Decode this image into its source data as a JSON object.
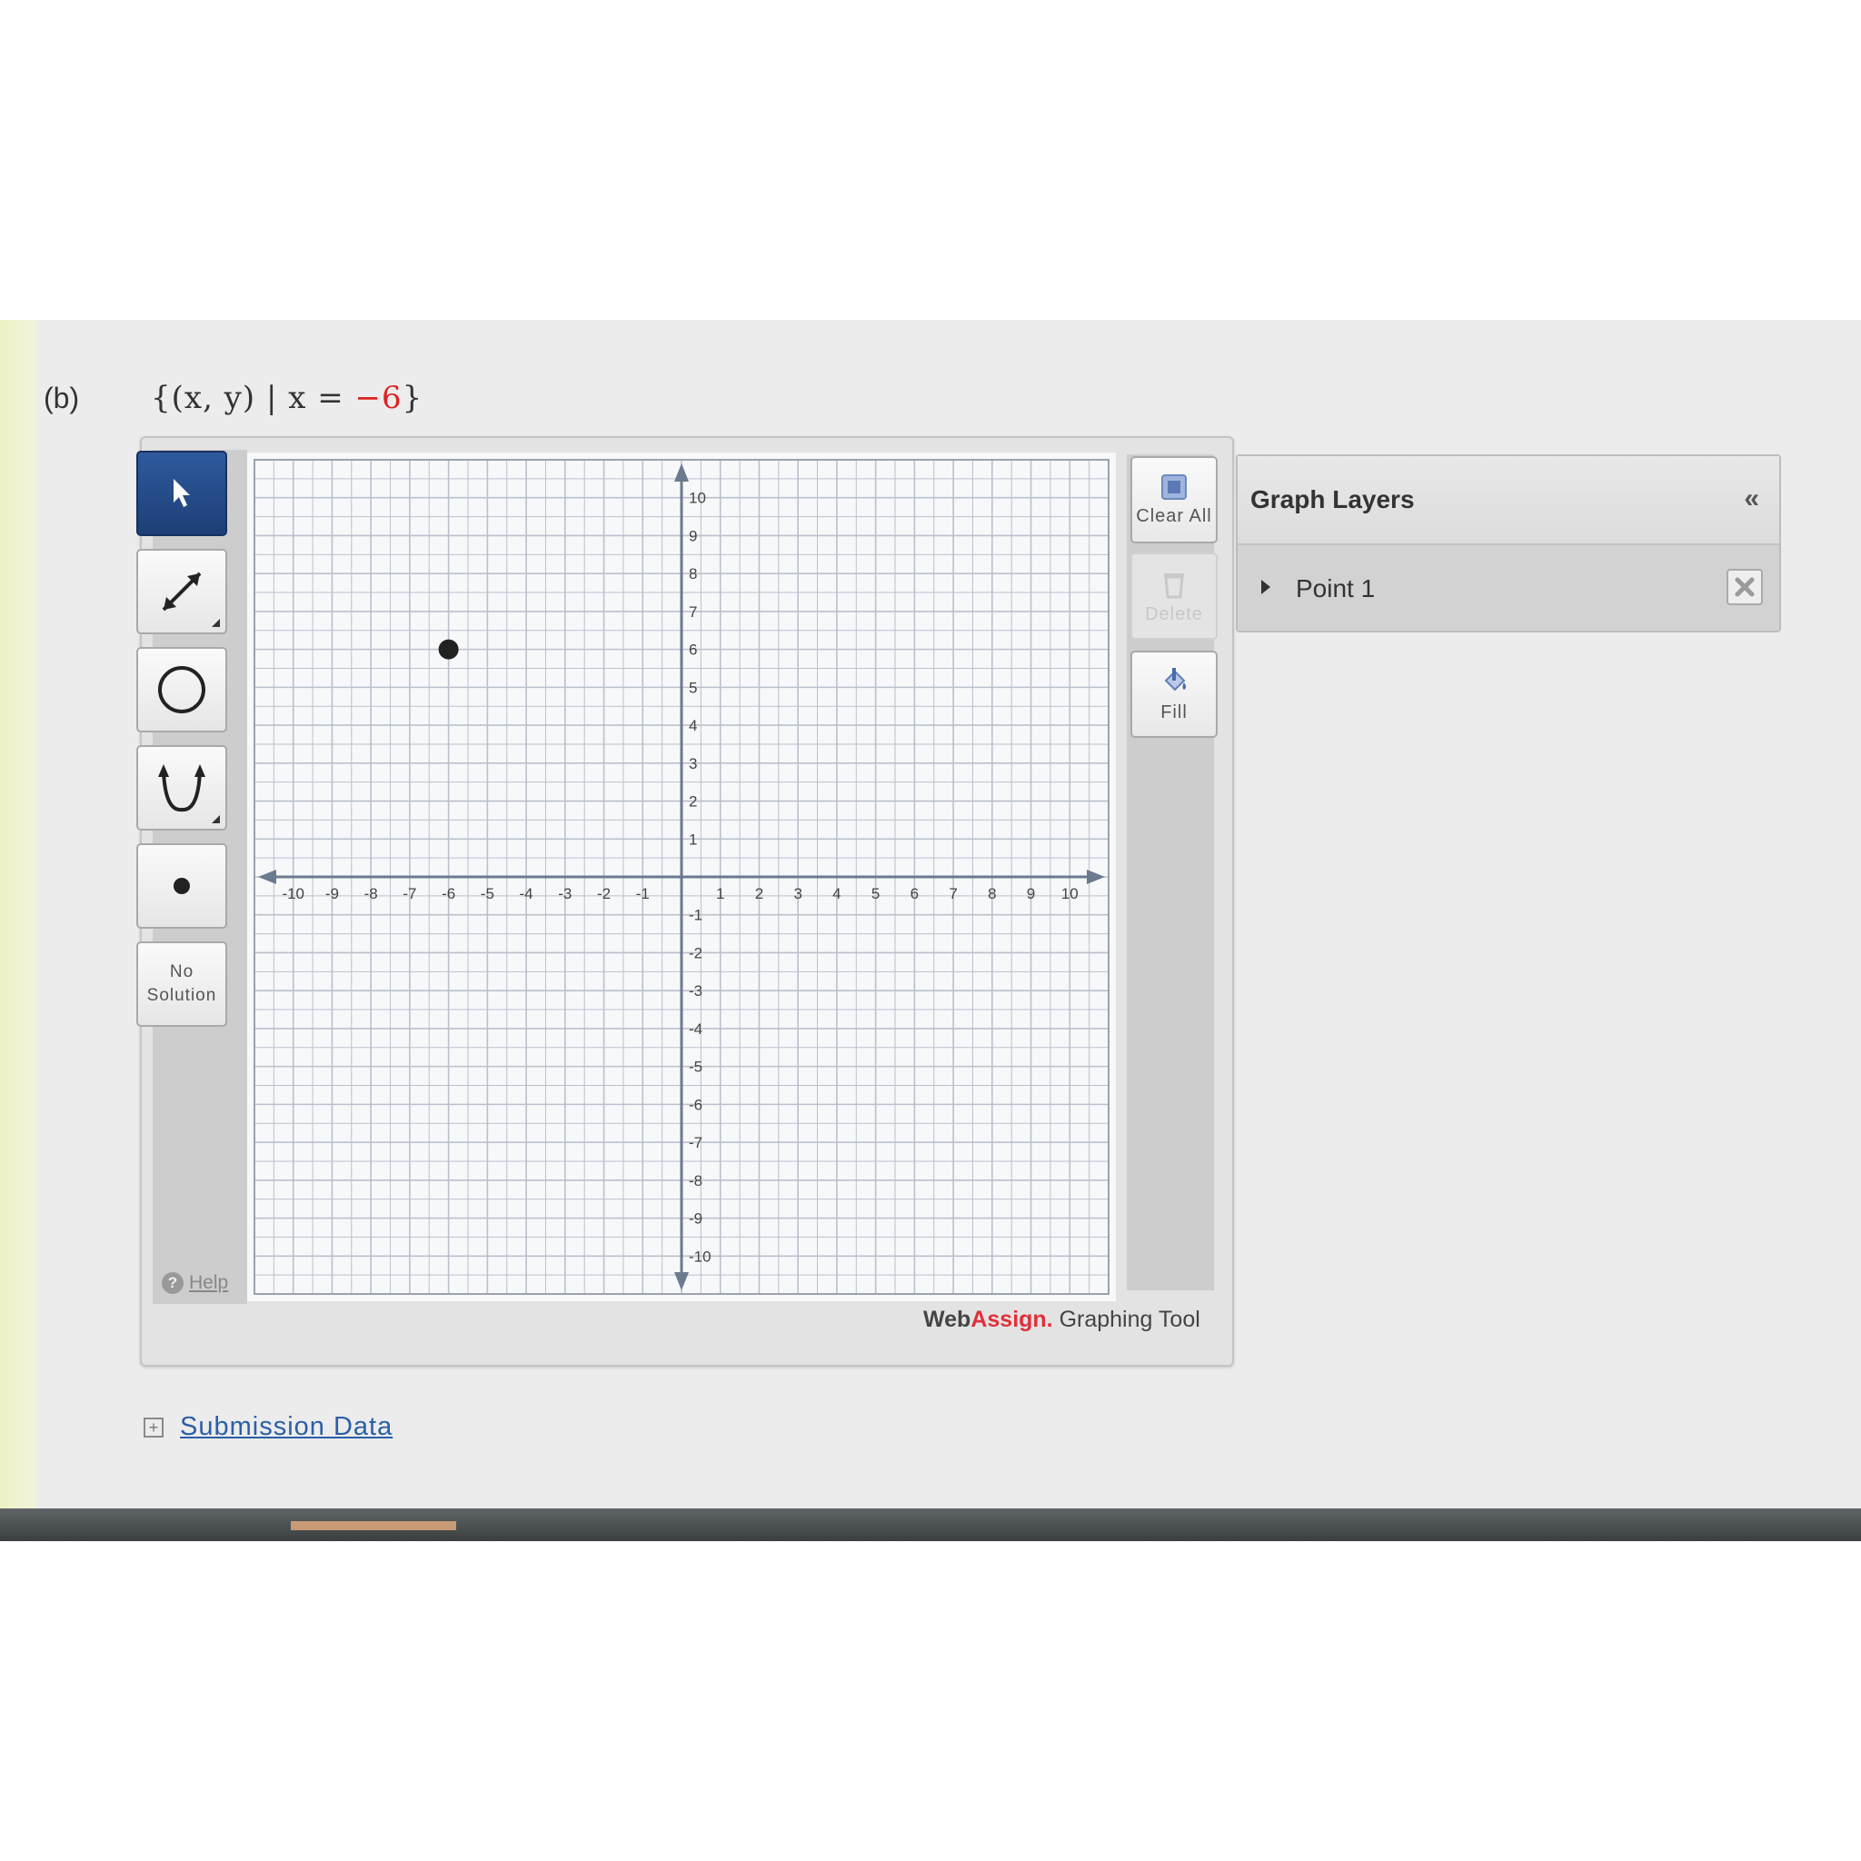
{
  "question": {
    "part_label": "(b)",
    "set_prefix": "{(x, y) | x = ",
    "set_value": "−6",
    "set_suffix": "}"
  },
  "toolbar": {
    "tools": [
      {
        "name": "select-tool",
        "icon": "pointer-arrow-icon",
        "active": true
      },
      {
        "name": "line-tool",
        "icon": "line-icon"
      },
      {
        "name": "circle-tool",
        "icon": "circle-icon"
      },
      {
        "name": "parabola-tool",
        "icon": "parabola-icon"
      },
      {
        "name": "point-tool",
        "icon": "point-icon"
      }
    ],
    "no_solution_line1": "No",
    "no_solution_line2": "Solution",
    "help_label": "Help"
  },
  "graph": {
    "x_range": [
      -10,
      10
    ],
    "y_range": [
      -10,
      10
    ],
    "grid": true,
    "x_tick_labels": [
      "-10",
      "-9",
      "-8",
      "-7",
      "-6",
      "-5",
      "-4",
      "-3",
      "-2",
      "-1",
      "1",
      "2",
      "3",
      "4",
      "5",
      "6",
      "7",
      "8",
      "9",
      "10"
    ],
    "y_tick_labels": [
      "10",
      "9",
      "8",
      "7",
      "6",
      "5",
      "4",
      "3",
      "2",
      "1",
      "-1",
      "-2",
      "-3",
      "-4",
      "-5",
      "-6",
      "-7",
      "-8",
      "-9",
      "-10"
    ],
    "points": [
      {
        "x": -6,
        "y": 6
      }
    ],
    "axis_color": "#6b7a8f",
    "grid_color": "#b9c1cc",
    "point_color": "#222222"
  },
  "right_toolbar": {
    "clear_all_label": "Clear All",
    "delete_label": "Delete",
    "fill_label": "Fill"
  },
  "branding": {
    "web": "Web",
    "assign": "Assign.",
    "rest": " Graphing Tool"
  },
  "layers": {
    "title": "Graph Layers",
    "collapse_symbol": "«",
    "items": [
      {
        "label": "Point 1"
      }
    ]
  },
  "submission": {
    "label": "Submission Data"
  }
}
